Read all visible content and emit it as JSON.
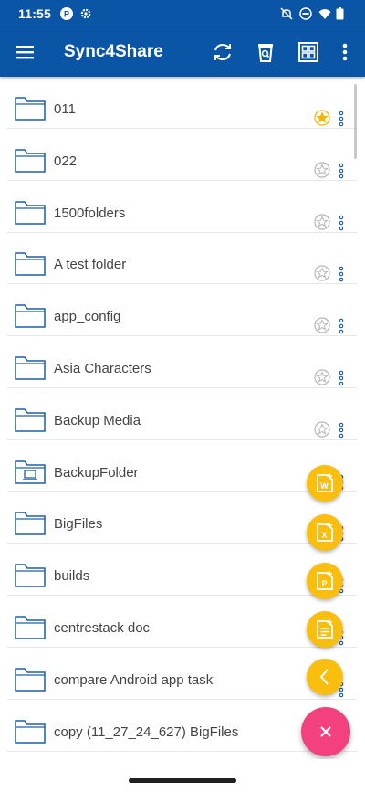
{
  "status_bar": {
    "time": "11:55",
    "left_icons": [
      "app-notification-icon",
      "settings-gear-icon"
    ],
    "right_icons": [
      "mute-icon",
      "do-not-disturb-icon",
      "wifi-icon",
      "battery-icon"
    ]
  },
  "app_bar": {
    "title": "Sync4Share",
    "icons": [
      "menu-icon",
      "sync-icon",
      "recycle-bin-icon",
      "grid-view-icon",
      "more-vert-icon"
    ]
  },
  "folders": [
    {
      "name": "011",
      "favorite": true,
      "type": "folder"
    },
    {
      "name": "022",
      "favorite": false,
      "type": "folder"
    },
    {
      "name": "1500folders",
      "favorite": false,
      "type": "folder"
    },
    {
      "name": "A test folder",
      "favorite": false,
      "type": "folder"
    },
    {
      "name": "app_config",
      "favorite": false,
      "type": "folder"
    },
    {
      "name": "Asia Characters",
      "favorite": false,
      "type": "folder"
    },
    {
      "name": "Backup Media",
      "favorite": false,
      "type": "folder"
    },
    {
      "name": "BackupFolder",
      "favorite": false,
      "type": "backup-folder"
    },
    {
      "name": "BigFiles",
      "favorite": false,
      "type": "folder"
    },
    {
      "name": "builds",
      "favorite": false,
      "type": "folder"
    },
    {
      "name": "centrestack doc",
      "favorite": false,
      "type": "folder"
    },
    {
      "name": "compare Android app task",
      "favorite": false,
      "type": "folder"
    },
    {
      "name": "copy (11_27_24_627) BigFiles",
      "favorite": false,
      "type": "folder"
    }
  ],
  "fab_menu": {
    "items": [
      "new-word-doc-icon",
      "new-excel-doc-icon",
      "new-powerpoint-doc-icon",
      "new-text-doc-icon",
      "collapse-chevron-icon"
    ],
    "main": "close-icon"
  },
  "colors": {
    "primary": "#0a55a5",
    "fab_accent": "#f9be0e",
    "fab_main": "#f34180",
    "folder_stroke": "#1f5fa8",
    "favorite_star": "#f2b500"
  }
}
